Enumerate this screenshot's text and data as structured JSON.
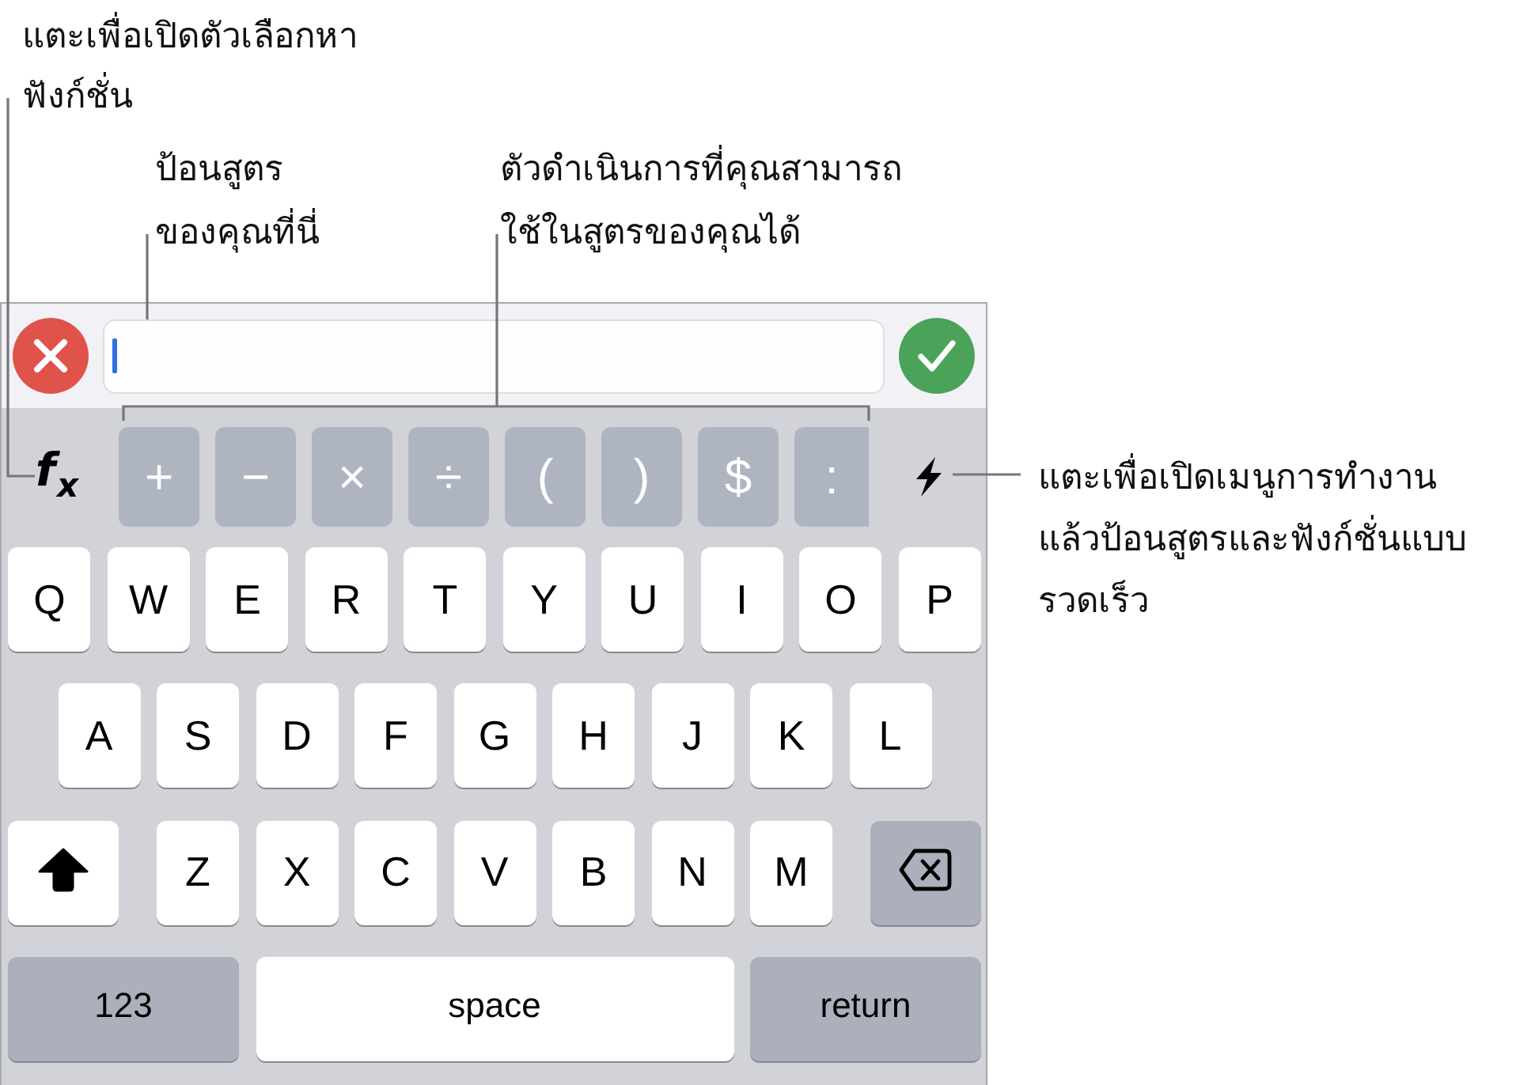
{
  "callouts": [
    {
      "lines": [
        "แตะเพื่อเปิดตัวเลือกหา",
        "ฟังก์ชั่น"
      ]
    },
    {
      "lines": [
        "ป้อนสูตร",
        "ของคุณที่นี่"
      ]
    },
    {
      "lines": [
        "ตัวดำเนินการที่คุณสามารถ",
        "ใช้ในสูตรของคุณได้"
      ]
    },
    {
      "lines": [
        "แตะเพื่อเปิดเมนูการทำงาน",
        "แล้วป้อนสูตรและฟังก์ชั่นแบบ",
        "รวดเร็ว"
      ]
    }
  ],
  "formula_bar": {
    "input": {
      "focused": true
    }
  },
  "operator_bar": {
    "function_button": "f$_{x}$",
    "operators": [
      "+",
      "−",
      "×",
      "÷",
      "(",
      ")",
      "$",
      ":"
    ]
  },
  "keyboard": {
    "letter_rows": [
      [
        {
          "kind": "letter",
          "label": "Q"
        },
        {
          "kind": "letter",
          "label": "W"
        },
        {
          "kind": "letter",
          "label": "E"
        },
        {
          "kind": "letter",
          "label": "R"
        },
        {
          "kind": "letter",
          "label": "T"
        },
        {
          "kind": "letter",
          "label": "Y"
        },
        {
          "kind": "letter",
          "label": "U"
        },
        {
          "kind": "letter",
          "label": "I"
        },
        {
          "kind": "letter",
          "label": "O"
        },
        {
          "kind": "letter",
          "label": "P"
        }
      ],
      [
        {
          "kind": "letter",
          "label": "A"
        },
        {
          "kind": "letter",
          "label": "S"
        },
        {
          "kind": "letter",
          "label": "D"
        },
        {
          "kind": "letter",
          "label": "F"
        },
        {
          "kind": "letter",
          "label": "G"
        },
        {
          "kind": "letter",
          "label": "H"
        },
        {
          "kind": "letter",
          "label": "J"
        },
        {
          "kind": "letter",
          "label": "K"
        },
        {
          "kind": "letter",
          "label": "L"
        }
      ],
      [
        {
          "kind": "shift"
        },
        {
          "kind": "letter",
          "label": "Z"
        },
        {
          "kind": "letter",
          "label": "X"
        },
        {
          "kind": "letter",
          "label": "C"
        },
        {
          "kind": "letter",
          "label": "V"
        },
        {
          "kind": "letter",
          "label": "B"
        },
        {
          "kind": "letter",
          "label": "N"
        },
        {
          "kind": "letter",
          "label": "M"
        },
        {
          "kind": "delete"
        }
      ]
    ],
    "bottom_row": [
      {
        "kind": "numbers",
        "label": "123"
      },
      {
        "kind": "space",
        "label": "space"
      },
      {
        "kind": "return",
        "label": "return"
      }
    ]
  }
}
